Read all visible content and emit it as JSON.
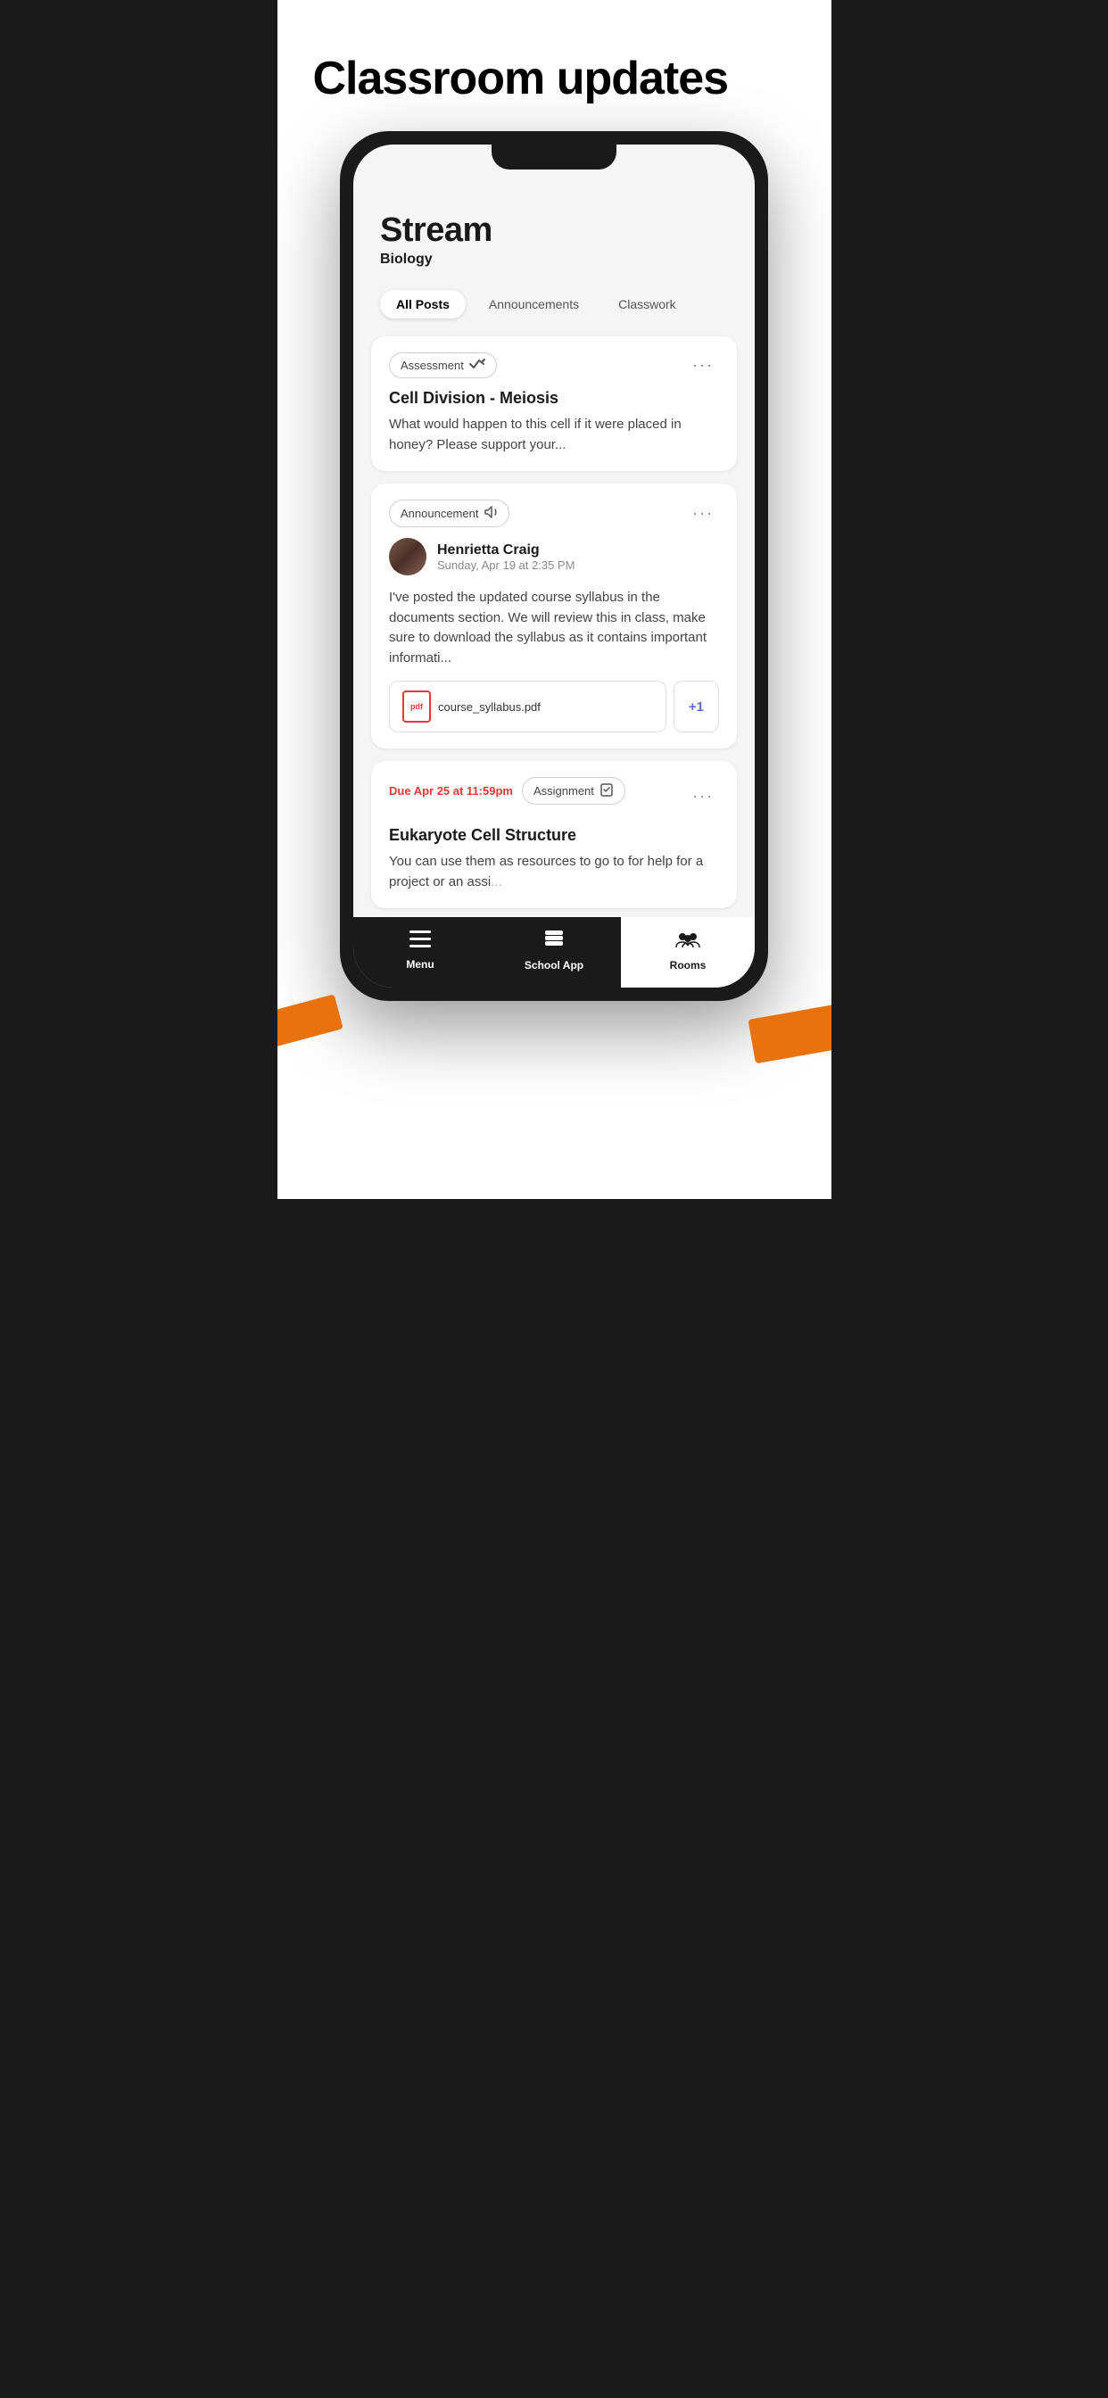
{
  "page": {
    "title": "Classroom updates",
    "background_color": "#ffffff"
  },
  "stream": {
    "title": "Stream",
    "subtitle": "Biology"
  },
  "tabs": [
    {
      "label": "All Posts",
      "active": true
    },
    {
      "label": "Announcements",
      "active": false
    },
    {
      "label": "Classwork",
      "active": false
    }
  ],
  "cards": [
    {
      "type": "assessment",
      "badge_label": "Assessment",
      "title": "Cell Division - Meiosis",
      "body": "What would happen to this cell if it were placed in honey? Please support your...",
      "more": "···"
    },
    {
      "type": "announcement",
      "badge_label": "Announcement",
      "author_name": "Henrietta Craig",
      "author_date": "Sunday, Apr 19 at 2:35 PM",
      "body": "I've posted the updated course syllabus in the documents section. We will review this in class, make sure to download the syllabus as it contains important informati...",
      "attachment_name": "course_syllabus.pdf",
      "attachment_plus": "+1",
      "more": "···"
    },
    {
      "type": "assignment",
      "due_label": "Due Apr 25 at 11:59pm",
      "badge_label": "Assignment",
      "title": "Eukaryote Cell Structure",
      "body": "You can use them as resources to go to for help  for a project or an assi...",
      "more": "···"
    }
  ],
  "bottom_nav": [
    {
      "label": "Menu",
      "icon": "menu"
    },
    {
      "label": "School App",
      "icon": "layers"
    },
    {
      "label": "Rooms",
      "icon": "rooms"
    }
  ]
}
